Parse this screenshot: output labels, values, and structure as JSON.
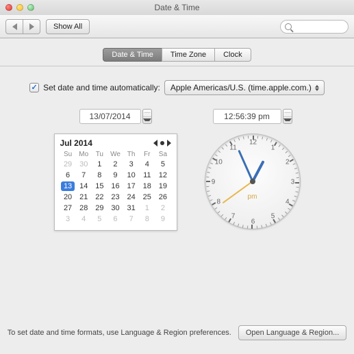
{
  "window": {
    "title": "Date & Time"
  },
  "toolbar": {
    "show_all": "Show All",
    "search_placeholder": ""
  },
  "tabs": [
    "Date & Time",
    "Time Zone",
    "Clock"
  ],
  "active_tab": 0,
  "auto": {
    "label": "Set date and time automatically:",
    "checked": true,
    "server": "Apple Americas/U.S. (time.apple.com.)"
  },
  "date_field": "13/07/2014",
  "time_field": "12:56:39 pm",
  "calendar": {
    "month_label": "Jul 2014",
    "weekdays": [
      "Su",
      "Mo",
      "Tu",
      "We",
      "Th",
      "Fr",
      "Sa"
    ],
    "grid": [
      [
        {
          "d": 29,
          "out": true
        },
        {
          "d": 30,
          "out": true
        },
        {
          "d": 1
        },
        {
          "d": 2
        },
        {
          "d": 3
        },
        {
          "d": 4
        },
        {
          "d": 5
        }
      ],
      [
        {
          "d": 6
        },
        {
          "d": 7
        },
        {
          "d": 8
        },
        {
          "d": 9
        },
        {
          "d": 10
        },
        {
          "d": 11
        },
        {
          "d": 12
        }
      ],
      [
        {
          "d": 13,
          "sel": true
        },
        {
          "d": 14
        },
        {
          "d": 15
        },
        {
          "d": 16
        },
        {
          "d": 17
        },
        {
          "d": 18
        },
        {
          "d": 19
        }
      ],
      [
        {
          "d": 20
        },
        {
          "d": 21
        },
        {
          "d": 22
        },
        {
          "d": 23
        },
        {
          "d": 24
        },
        {
          "d": 25
        },
        {
          "d": 26
        }
      ],
      [
        {
          "d": 27
        },
        {
          "d": 28
        },
        {
          "d": 29
        },
        {
          "d": 30
        },
        {
          "d": 31
        },
        {
          "d": 1,
          "out": true
        },
        {
          "d": 2,
          "out": true
        }
      ],
      [
        {
          "d": 3,
          "out": true
        },
        {
          "d": 4,
          "out": true
        },
        {
          "d": 5,
          "out": true
        },
        {
          "d": 6,
          "out": true
        },
        {
          "d": 7,
          "out": true
        },
        {
          "d": 8,
          "out": true
        },
        {
          "d": 9,
          "out": true
        }
      ]
    ]
  },
  "clock": {
    "hour": 12,
    "minute": 56,
    "second": 39,
    "ampm": "pm",
    "numbers": [
      "12",
      "1",
      "2",
      "3",
      "4",
      "5",
      "6",
      "7",
      "8",
      "9",
      "10",
      "11"
    ]
  },
  "footer": {
    "text": "To set date and time formats, use Language & Region preferences.",
    "button": "Open Language & Region..."
  }
}
